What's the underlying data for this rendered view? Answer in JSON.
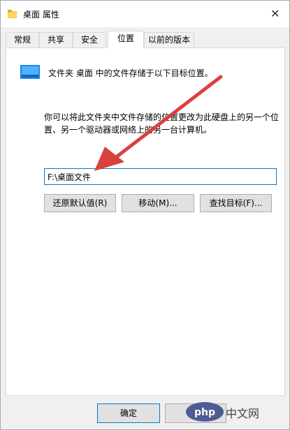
{
  "window": {
    "title": "桌面 属性",
    "close_glyph": "✕"
  },
  "tabs": [
    {
      "label": "常规"
    },
    {
      "label": "共享"
    },
    {
      "label": "安全"
    },
    {
      "label": "位置",
      "active": true
    },
    {
      "label": "以前的版本"
    }
  ],
  "location": {
    "description": "文件夹 桌面 中的文件存储于以下目标位置。",
    "help_text": "你可以将此文件夹中文件存储的位置更改为此硬盘上的另一个位置、另一个驱动器或网络上的另一台计算机。",
    "path_value": "F:\\桌面文件",
    "restore_default_label": "还原默认值(R)",
    "move_label": "移动(M)...",
    "find_target_label": "查找目标(F)..."
  },
  "footer": {
    "ok_label": "确定",
    "cancel_label": "取消"
  },
  "watermark": {
    "logo_text": "php",
    "label": "中文网"
  },
  "colors": {
    "arrow": "#d9413d",
    "focus_border": "#0078d7",
    "watermark_logo": "#4f5b93"
  }
}
